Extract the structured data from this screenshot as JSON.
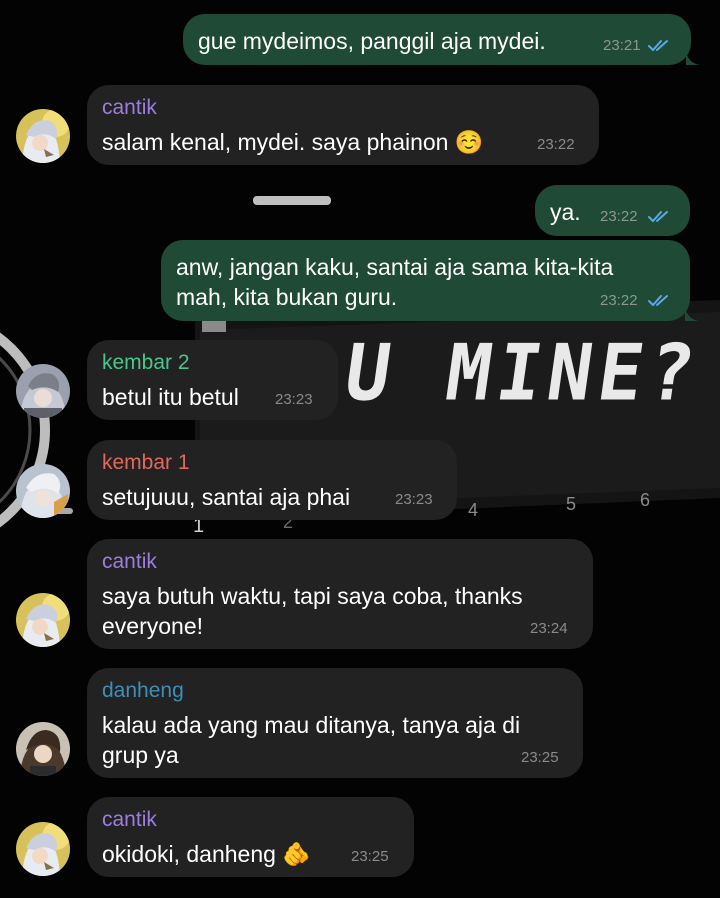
{
  "colors": {
    "outgoing_bubble": "#1f4a35",
    "incoming_bubble": "#222222",
    "read_ticks": "#5aa9e6",
    "name_cantik": "#9d7ee0",
    "name_kembar2": "#49c68c",
    "name_kembar1": "#e0685e",
    "name_danheng": "#3f8eb8"
  },
  "wallpaper": {
    "text": "U MINE?",
    "digits": [
      "1",
      "2",
      "4",
      "5",
      "6"
    ]
  },
  "messages": [
    {
      "direction": "out",
      "text": "gue mydeimos, panggil aja mydei.",
      "time": "23:21",
      "status": "read-double-tick"
    },
    {
      "direction": "in",
      "sender": "cantik",
      "avatar_icon": "anime-avatar-icon",
      "text": "salam kenal, mydei. saya phainon ☺️",
      "time": "23:22"
    },
    {
      "direction": "out",
      "text": "ya.",
      "time": "23:22",
      "status": "read-double-tick"
    },
    {
      "direction": "out",
      "lines": [
        "anw, jangan kaku, santai aja sama kita-kita",
        "mah, kita bukan guru."
      ],
      "time": "23:22",
      "status": "read-double-tick"
    },
    {
      "direction": "in",
      "sender": "kembar 2",
      "avatar_icon": "anime-avatar-icon",
      "text": "betul itu betul",
      "time": "23:23"
    },
    {
      "direction": "in",
      "sender": "kembar 1",
      "avatar_icon": "anime-avatar-icon",
      "text": "setujuuu, santai aja phai",
      "time": "23:23"
    },
    {
      "direction": "in",
      "sender": "cantik",
      "avatar_icon": "anime-avatar-icon",
      "lines": [
        "saya butuh waktu, tapi saya coba, thanks",
        "everyone!"
      ],
      "time": "23:24"
    },
    {
      "direction": "in",
      "sender": "danheng",
      "avatar_icon": "anime-avatar-icon",
      "lines": [
        "kalau ada yang mau ditanya, tanya aja di",
        "grup ya"
      ],
      "time": "23:25"
    },
    {
      "direction": "in",
      "sender": "cantik",
      "avatar_icon": "anime-avatar-icon",
      "text": "okidoki, danheng 🫵",
      "time": "23:25"
    }
  ]
}
